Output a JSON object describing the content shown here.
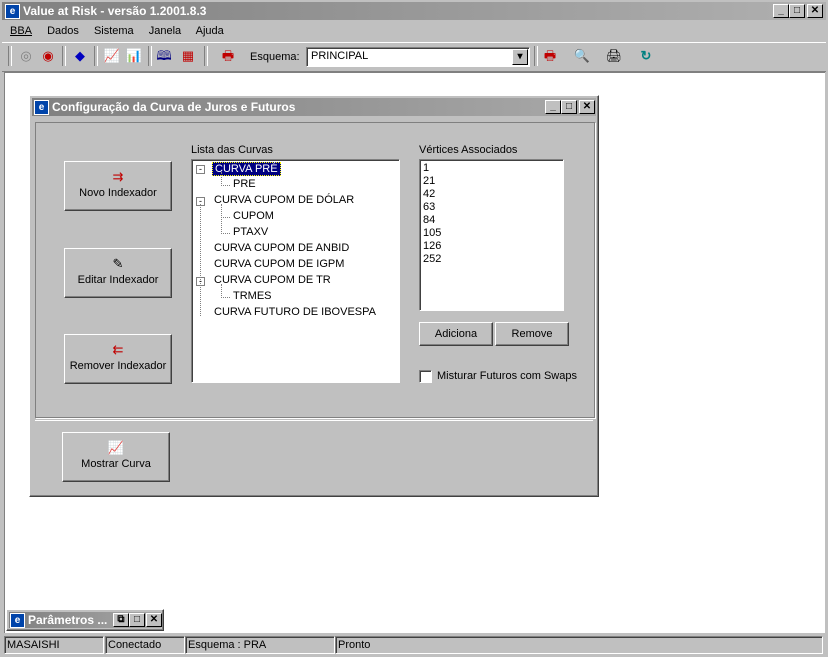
{
  "app": {
    "title": "Value at Risk - versão 1.2001.8.3",
    "icon": "app-logo-icon",
    "controls": {
      "minimize": "_",
      "maximize": "□",
      "close": "✕"
    }
  },
  "menu": [
    "BBA",
    "Dados",
    "Sistema",
    "Janela",
    "Ajuda"
  ],
  "toolbar": {
    "esquema_label": "Esquema:",
    "esquema_value": "PRINCIPAL",
    "icons": [
      "record-off-icon",
      "record-on-icon",
      "eraser-icon",
      "chart-icon",
      "chart-multi-icon",
      "book-icon",
      "grid-chart-icon",
      "printer-icon",
      "printer-red-icon",
      "search-people-icon",
      "printer-setup-icon",
      "refresh-icon"
    ]
  },
  "dialog": {
    "title": "Configuração da Curva de Juros e Futuros",
    "buttons": {
      "novo": "Novo Indexador",
      "editar": "Editar Indexador",
      "remover": "Remover Indexador",
      "mostrar": "Mostrar Curva",
      "adiciona": "Adiciona",
      "remove": "Remove"
    },
    "lista_label": "Lista das Curvas",
    "tree": [
      {
        "label": "CURVA PRÉ",
        "level": 0,
        "expanded": true,
        "selected": true
      },
      {
        "label": "PRE",
        "level": 1
      },
      {
        "label": "CURVA CUPOM DE DÓLAR",
        "level": 0,
        "expanded": true
      },
      {
        "label": "CUPOM",
        "level": 1
      },
      {
        "label": "PTAXV",
        "level": 1
      },
      {
        "label": "CURVA CUPOM DE ANBID",
        "level": 0
      },
      {
        "label": "CURVA CUPOM DE IGPM",
        "level": 0
      },
      {
        "label": "CURVA CUPOM DE TR",
        "level": 0,
        "expanded": true
      },
      {
        "label": "TRMES",
        "level": 1
      },
      {
        "label": "CURVA FUTURO DE IBOVESPA",
        "level": 0
      }
    ],
    "vertices_label": "Vértices Associados",
    "vertices": [
      "1",
      "21",
      "42",
      "63",
      "84",
      "105",
      "126",
      "252"
    ],
    "checkbox_label": "Misturar Futuros com Swaps",
    "checkbox_checked": false
  },
  "minimized_window": {
    "title": "Parâmetros ..."
  },
  "status": [
    "MASAISHI",
    "Conectado",
    "Esquema : PRA",
    "Pronto"
  ]
}
